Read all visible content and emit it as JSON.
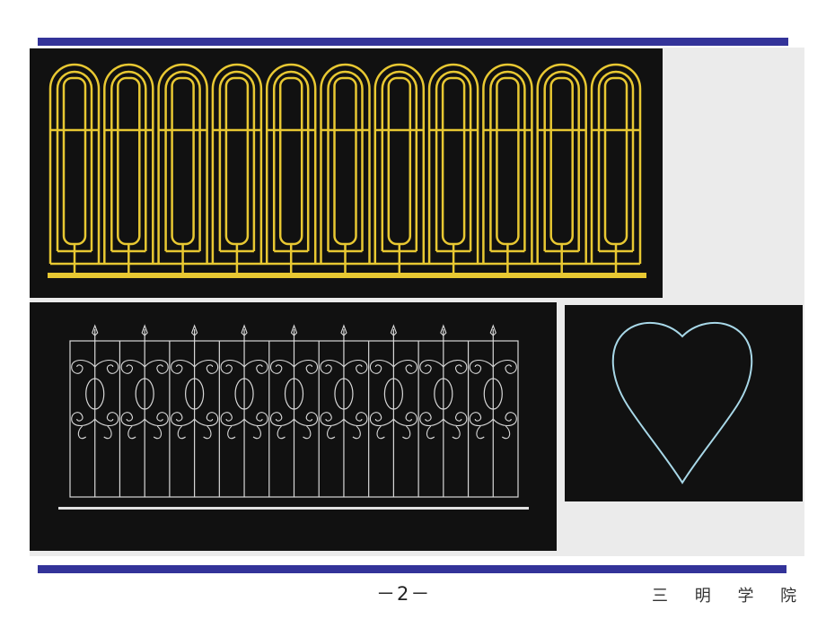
{
  "slide": {
    "page_number": "－2－",
    "institution": "三 明 学 院"
  },
  "images": [
    {
      "id": "gold-arch-fence",
      "description_name": "gold-arch-railing-drawing",
      "line_color": "#e8c832",
      "arch_count": 11
    },
    {
      "id": "white-scroll-fence",
      "description_name": "white-scroll-railing-drawing",
      "line_color": "#d8d8d8",
      "bay_count": 9
    },
    {
      "id": "heart-outline",
      "description_name": "heart-outline-drawing",
      "line_color": "#a8d8e8"
    }
  ],
  "colors": {
    "rule_bar": "#333399",
    "image_background": "#111111",
    "panel_background": "#ebebeb"
  }
}
